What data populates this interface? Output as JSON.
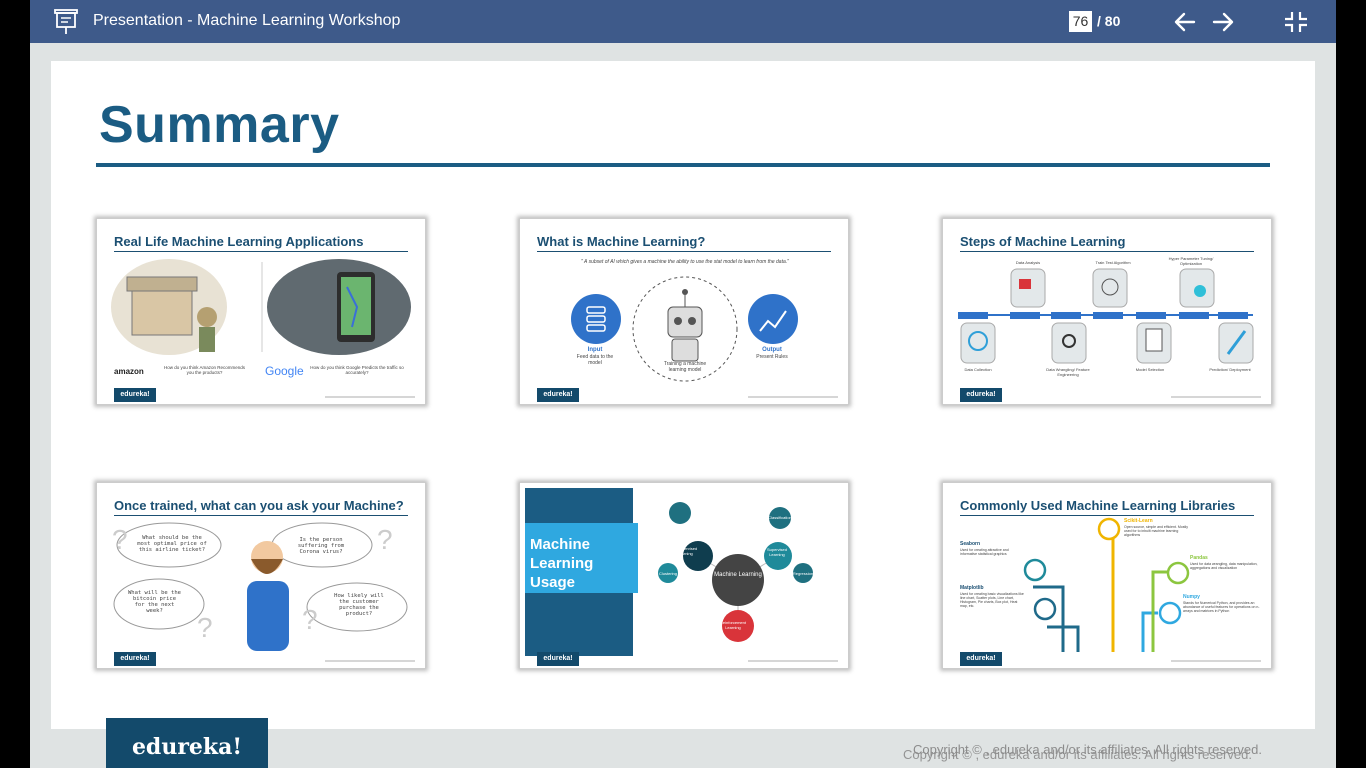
{
  "toolbar": {
    "title": "Presentation - Machine Learning Workshop",
    "current_page": "76",
    "total_pages": "/ 80"
  },
  "slide": {
    "title": "Summary",
    "thumbnails": [
      {
        "title": "Real Life Machine Learning Applications",
        "badge": "edureka!",
        "texts": [
          "amazon",
          "Google",
          "How do you think Amazon Recommends you the products?",
          "How do you think Google Predicts the traffic so accurately?"
        ]
      },
      {
        "title": "What is Machine Learning?",
        "badge": "edureka!",
        "texts": [
          "\" A subset of AI which gives a machine the ability to use the stat model to learn from the data.\"",
          "Input",
          "Feed data to the model",
          "Training a machine learning model",
          "Output",
          "Present Rules"
        ]
      },
      {
        "title": "Steps of Machine Learning",
        "badge": "edureka!",
        "texts": [
          "Data Analysis",
          "Train Test Algorithm",
          "Hyper Parameter Tuning/ Optimization",
          "Data Collection",
          "Data Wrangling/ Feature Engineering",
          "Model Selection",
          "Prediction/ Deployment"
        ]
      },
      {
        "title": "Once trained, what can you ask your Machine?",
        "badge": "edureka!",
        "texts": [
          "What should be the most optimal price of this airline ticket?",
          "Is the person suffering from Corona virus?",
          "What will be the bitcoin price for the next week?",
          "How likely will the customer purchase the product?"
        ]
      },
      {
        "title": "Machine Learning Usage",
        "badge": "edureka!",
        "texts": [
          "Machine Learning",
          "Unsupervised Learning",
          "Supervised Learning",
          "Reinforcement Learning",
          "Clustering",
          "Classification",
          "Regression"
        ]
      },
      {
        "title": "Commonly Used Machine Learning Libraries",
        "badge": "edureka!",
        "texts": [
          "Seaborn",
          "Used for creating attractive and informative statistical graphics",
          "Matplotlib",
          "Used for creating basic visualizations like line chart, Scatter plots, Line chart, Histogram, Pie charts, Box plot, Heat map, etc.",
          "Scikit-Learn",
          "Open source, simple and efficient. Mostly used for to inbuilt machine learning algorithms",
          "Pandas",
          "Used for data wrangling, data manipulation, aggregations and visualization",
          "Numpy",
          "Stands for Numerical Python, and provides an abundance of useful features for operations on n-arrays and matrices in Python"
        ]
      }
    ]
  },
  "footer": {
    "logo": "edureka!",
    "copyright": "Copyright © , edureka and/or its affiliates. All rights reserved."
  },
  "colors": {
    "toolbar": "#3e5a8a",
    "accent": "#1b5c83",
    "badge": "#134a6b"
  }
}
